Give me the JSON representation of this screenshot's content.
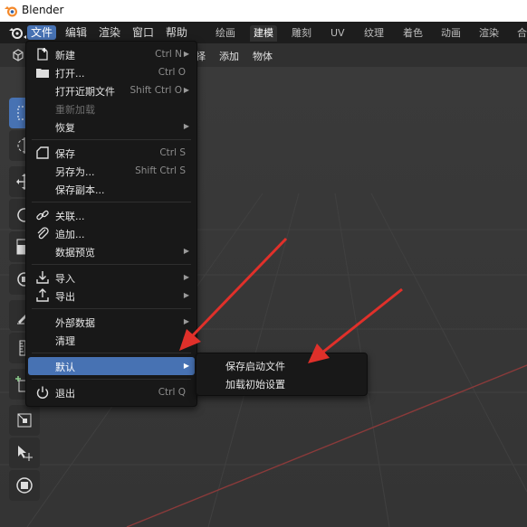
{
  "window": {
    "title": "Blender"
  },
  "topbar": {
    "menus": [
      "文件",
      "编辑",
      "渲染",
      "窗口",
      "帮助"
    ],
    "workspaces": [
      "绘画",
      "建模",
      "雕刻",
      "UV",
      "纹理",
      "着色",
      "动画",
      "渲染",
      "合"
    ],
    "active_workspace": "建模"
  },
  "header": {
    "items": [
      "择",
      "添加",
      "物体"
    ]
  },
  "file_menu": {
    "items": [
      {
        "label": "新建",
        "shortcut": "Ctrl N",
        "submenu": true,
        "icon": "new-file-icon"
      },
      {
        "label": "打开...",
        "shortcut": "Ctrl O",
        "icon": "folder-icon"
      },
      {
        "label": "打开近期文件",
        "shortcut": "Shift Ctrl O",
        "submenu": true
      },
      {
        "label": "重新加载",
        "disabled": true
      },
      {
        "label": "恢复",
        "submenu": true
      },
      {
        "label": "保存",
        "shortcut": "Ctrl S",
        "icon": "save-icon"
      },
      {
        "label": "另存为...",
        "shortcut": "Shift Ctrl S"
      },
      {
        "label": "保存副本..."
      },
      {
        "label": "关联...",
        "icon": "link-icon"
      },
      {
        "label": "追加...",
        "icon": "paperclip-icon"
      },
      {
        "label": "数据预览",
        "submenu": true
      },
      {
        "label": "导入",
        "submenu": true,
        "icon": "import-icon"
      },
      {
        "label": "导出",
        "submenu": true,
        "icon": "export-icon"
      },
      {
        "label": "外部数据",
        "submenu": true
      },
      {
        "label": "清理",
        "submenu": true
      },
      {
        "label": "默认",
        "submenu": true,
        "highlighted": true
      },
      {
        "label": "退出",
        "shortcut": "Ctrl Q",
        "icon": "power-icon"
      }
    ]
  },
  "defaults_submenu": {
    "items": [
      "保存启动文件",
      "加载初始设置"
    ]
  },
  "colors": {
    "accent": "#4772b3",
    "menu_bg": "#181818",
    "annotation_arrow": "#e0302a"
  }
}
